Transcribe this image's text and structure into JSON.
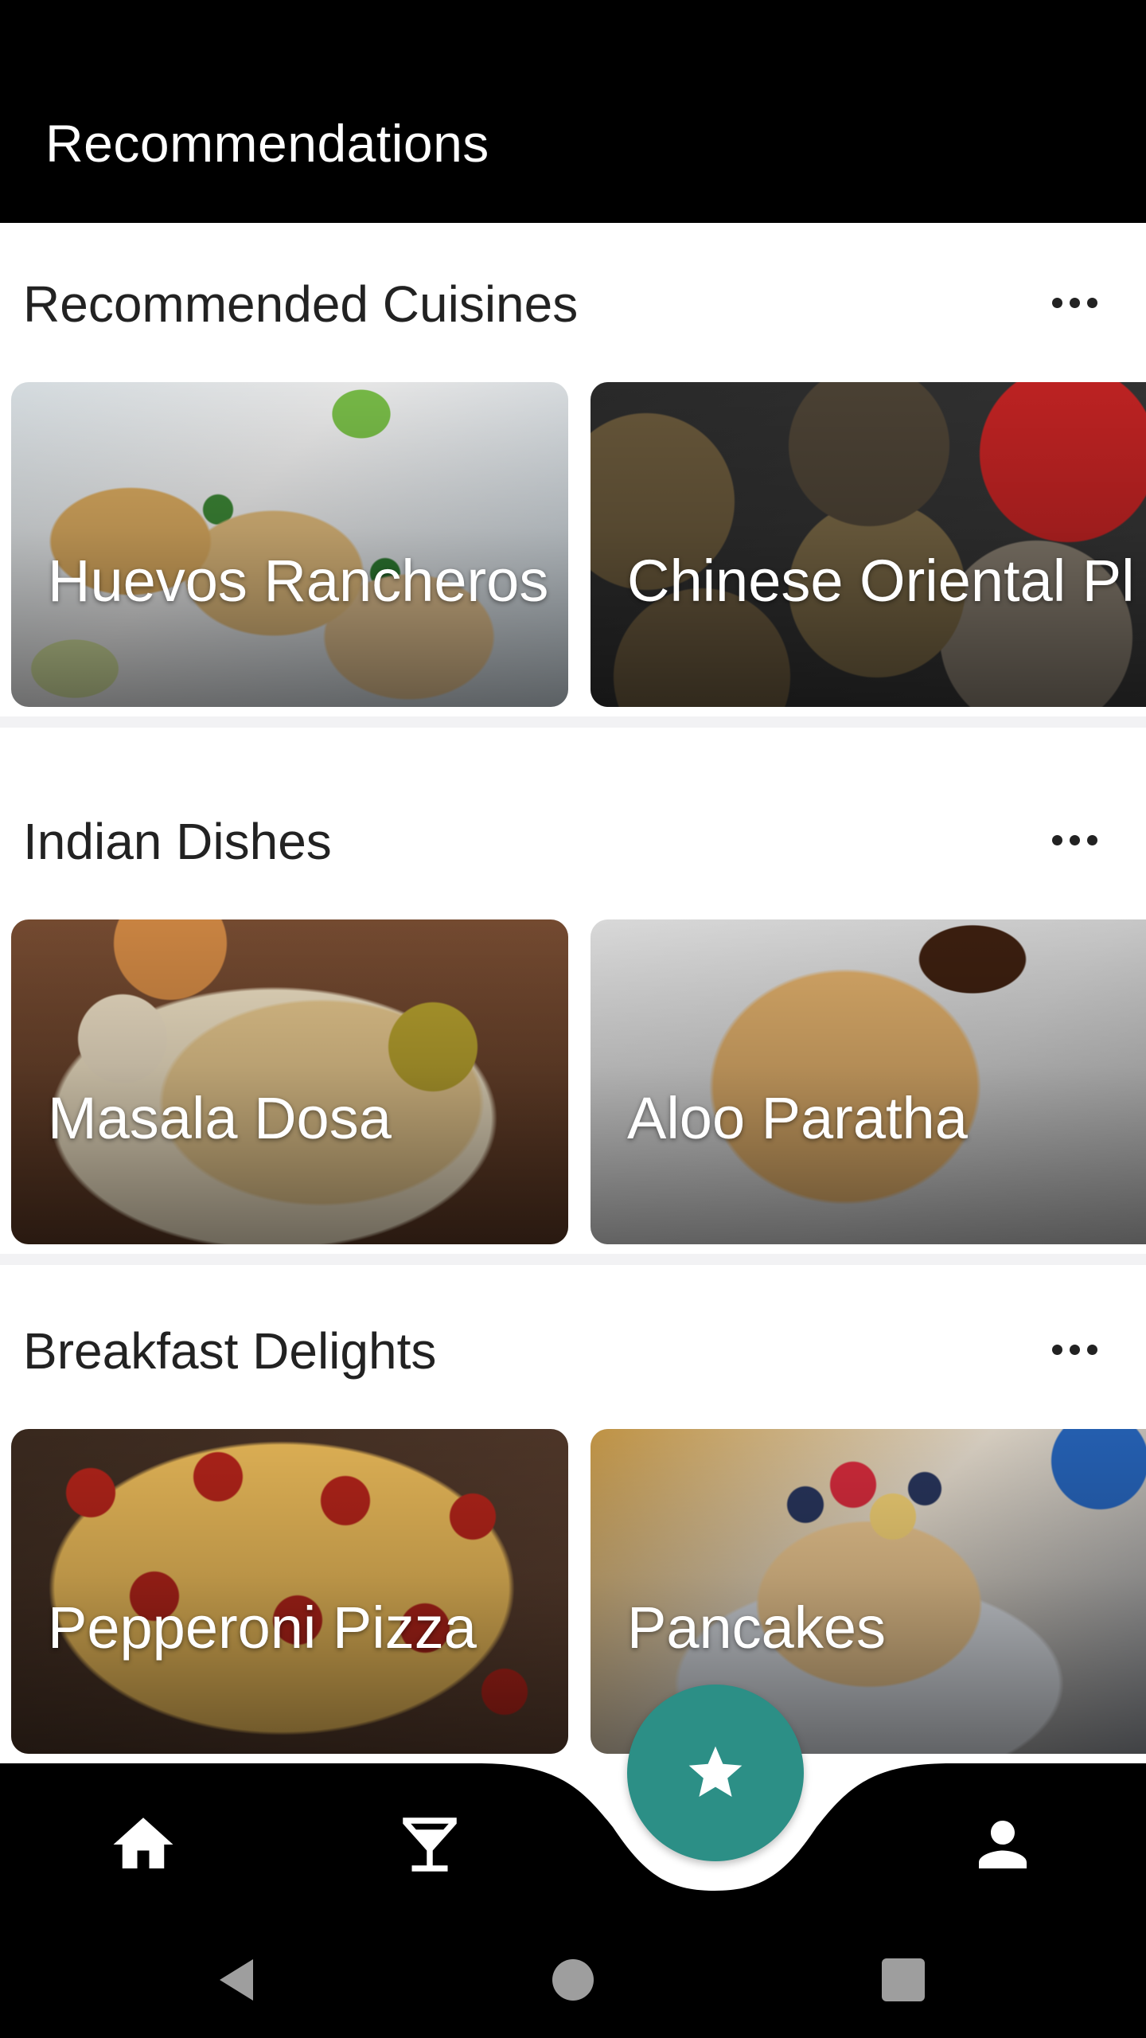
{
  "app_bar": {
    "title": "Recommendations"
  },
  "sections": [
    {
      "heading": "Recommended Cuisines",
      "cards": [
        {
          "label": "Huevos Rancheros"
        },
        {
          "label": "Chinese Oriental Pl"
        }
      ]
    },
    {
      "heading": "Indian Dishes",
      "cards": [
        {
          "label": "Masala Dosa"
        },
        {
          "label": "Aloo Paratha"
        }
      ]
    },
    {
      "heading": "Breakfast Delights",
      "cards": [
        {
          "label": "Pepperoni Pizza"
        },
        {
          "label": "Pancakes"
        }
      ]
    }
  ],
  "bottom_nav": {
    "items": [
      "home-icon",
      "cocktail-icon",
      "star-icon",
      "person-icon"
    ],
    "fab_color": "#2c8f86"
  },
  "system_nav": {
    "items": [
      "back-icon",
      "home-circle-icon",
      "recents-icon"
    ]
  }
}
